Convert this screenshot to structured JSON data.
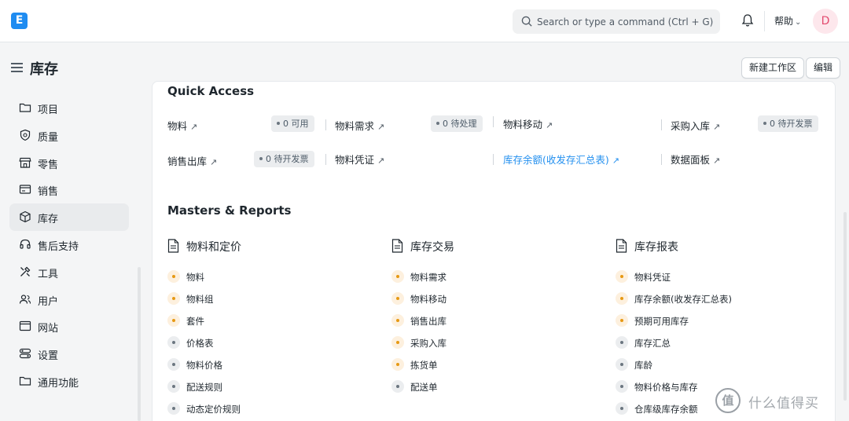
{
  "navbar": {
    "logo_letter": "E",
    "search_placeholder": "Search or type a command (Ctrl + G)",
    "help_label": "帮助",
    "avatar_initial": "D"
  },
  "page": {
    "title": "库存",
    "new_workspace_label": "新建工作区",
    "edit_label": "编辑"
  },
  "sidebar": {
    "items": [
      {
        "label": "项目",
        "icon": "folder-icon"
      },
      {
        "label": "质量",
        "icon": "shield-icon"
      },
      {
        "label": "零售",
        "icon": "store-icon"
      },
      {
        "label": "销售",
        "icon": "card-icon"
      },
      {
        "label": "库存",
        "icon": "box-icon",
        "active": true
      },
      {
        "label": "售后支持",
        "icon": "headset-icon"
      },
      {
        "label": "工具",
        "icon": "tools-icon"
      },
      {
        "label": "用户",
        "icon": "users-icon"
      },
      {
        "label": "网站",
        "icon": "browser-icon"
      },
      {
        "label": "设置",
        "icon": "settings-icon"
      },
      {
        "label": "通用功能",
        "icon": "folder-icon"
      }
    ]
  },
  "quick_access": {
    "title": "Quick Access",
    "items": [
      {
        "label": "物料",
        "badge": "0 可用"
      },
      {
        "label": "物料需求",
        "badge": "0 待处理"
      },
      {
        "label": "物料移动",
        "badge": ""
      },
      {
        "label": "采购入库",
        "badge": "0 待开发票"
      },
      {
        "label": "销售出库",
        "badge": "0 待开发票"
      },
      {
        "label": "物料凭证",
        "badge": ""
      },
      {
        "label": "库存余额(收发存汇总表)",
        "badge": "",
        "link": true
      },
      {
        "label": "数据面板",
        "badge": ""
      }
    ]
  },
  "masters_reports": {
    "title": "Masters & Reports",
    "columns": [
      {
        "title": "物料和定价",
        "links": [
          {
            "label": "物料",
            "color": "orange"
          },
          {
            "label": "物料组",
            "color": "orange"
          },
          {
            "label": "套件",
            "color": "orange"
          },
          {
            "label": "价格表",
            "color": "gray"
          },
          {
            "label": "物料价格",
            "color": "gray"
          },
          {
            "label": "配送规则",
            "color": "gray"
          },
          {
            "label": "动态定价规则",
            "color": "gray"
          }
        ]
      },
      {
        "title": "库存交易",
        "links": [
          {
            "label": "物料需求",
            "color": "orange"
          },
          {
            "label": "物料移动",
            "color": "orange"
          },
          {
            "label": "销售出库",
            "color": "orange"
          },
          {
            "label": "采购入库",
            "color": "orange"
          },
          {
            "label": "拣货单",
            "color": "orange"
          },
          {
            "label": "配送单",
            "color": "gray"
          }
        ]
      },
      {
        "title": "库存报表",
        "links": [
          {
            "label": "物料凭证",
            "color": "orange"
          },
          {
            "label": "库存余额(收发存汇总表)",
            "color": "orange"
          },
          {
            "label": "预期可用库存",
            "color": "orange"
          },
          {
            "label": "库存汇总",
            "color": "gray"
          },
          {
            "label": "库龄",
            "color": "gray"
          },
          {
            "label": "物料价格与库存",
            "color": "gray"
          },
          {
            "label": "仓库级库存余额",
            "color": "gray"
          }
        ]
      }
    ]
  },
  "watermark": {
    "logo": "值",
    "text": "什么值得买"
  },
  "colors": {
    "accent": "#2490ef",
    "orange_dot": "#e79913",
    "gray_dot": "#6b7680"
  }
}
